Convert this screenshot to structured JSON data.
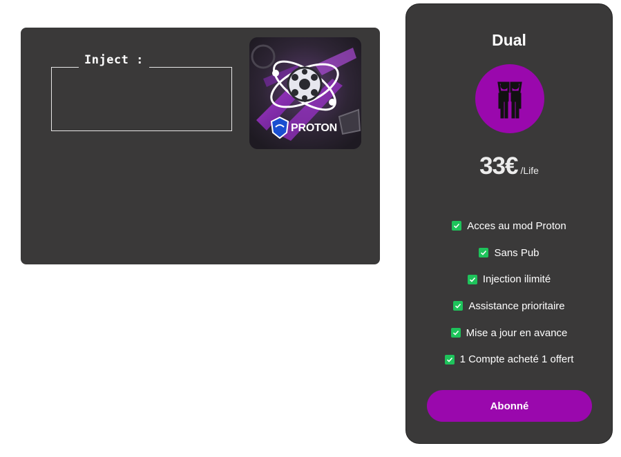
{
  "inject_panel": {
    "title": "Inject :",
    "logo_text": "PROTON",
    "logo_icon": "proton-logo-icon"
  },
  "pricing": {
    "plan_name": "Dual",
    "plan_icon": "two-people-icon",
    "price": "33€",
    "period": "/Life",
    "features": [
      "Acces au mod Proton",
      "Sans Pub",
      "Injection ilimité",
      "Assistance prioritaire",
      "Mise a jour en avance",
      "1 Compte acheté 1 offert"
    ],
    "subscribe_label": "Abonné"
  },
  "colors": {
    "panel_bg": "#3a3939",
    "accent": "#9a08ad",
    "check": "#1ec35b"
  }
}
